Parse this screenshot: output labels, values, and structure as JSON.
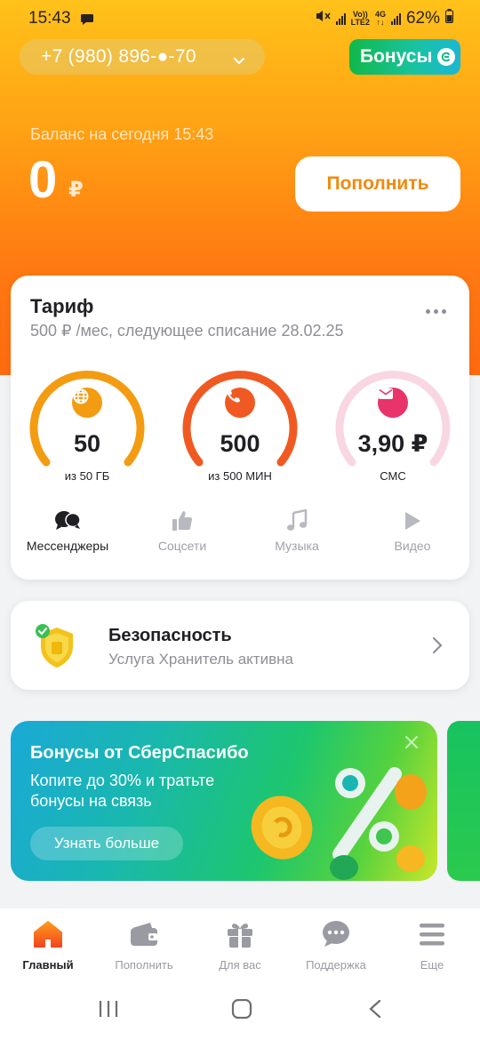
{
  "status_bar": {
    "time": "15:43",
    "network_top": "Vo))",
    "network_bottom": "LTE2",
    "network_type": "4G",
    "battery": "62%"
  },
  "header": {
    "phone": "+7 (980) 896-●-70",
    "bonus_label": "Бонусы"
  },
  "balance": {
    "label": "Баланс на сегодня 15:43",
    "amount": "0",
    "currency": "₽",
    "topup_label": "Пополнить"
  },
  "tariff": {
    "title": "Тариф",
    "subtitle": "500 ₽ /мес, следующее списание 28.02.25",
    "gauges": [
      {
        "value": "50",
        "label": "из 50 ГБ",
        "icon": "globe-icon",
        "color": "#f39c12",
        "fill": 1.0
      },
      {
        "value": "500",
        "label": "из 500 МИН",
        "icon": "phone-icon",
        "color": "#f05a22",
        "fill": 1.0
      },
      {
        "value": "3,90 ₽",
        "label": "СМС",
        "icon": "envelope-icon",
        "color": "#f4c8d6",
        "icon_color": "#e8336b",
        "fill": 1.0
      }
    ],
    "categories": [
      {
        "label": "Мессенджеры",
        "icon": "chat-bubbles-icon",
        "active": true
      },
      {
        "label": "Соцсети",
        "icon": "thumbs-up-icon",
        "active": false
      },
      {
        "label": "Музыка",
        "icon": "music-note-icon",
        "active": false
      },
      {
        "label": "Видео",
        "icon": "play-icon",
        "active": false
      }
    ]
  },
  "security": {
    "title": "Безопасность",
    "subtitle": "Услуга Хранитель активна",
    "icon": "shield-check-icon"
  },
  "promo": {
    "title": "Бонусы от СберСпасибо",
    "text": "Копите до 30% и тратьте бонусы на связь",
    "button": "Узнать больше"
  },
  "tab_bar": [
    {
      "label": "Главный",
      "icon": "home-icon",
      "active": true
    },
    {
      "label": "Пополнить",
      "icon": "wallet-icon",
      "active": false
    },
    {
      "label": "Для вас",
      "icon": "gift-icon",
      "active": false
    },
    {
      "label": "Поддержка",
      "icon": "chat-icon",
      "active": false
    },
    {
      "label": "Еще",
      "icon": "menu-icon",
      "active": false
    }
  ],
  "colors": {
    "accent_orange": "#ff7a12",
    "accent_yellow": "#ffc21a",
    "topup_text": "#f08a0c",
    "bonus_green": "#11b84a"
  }
}
